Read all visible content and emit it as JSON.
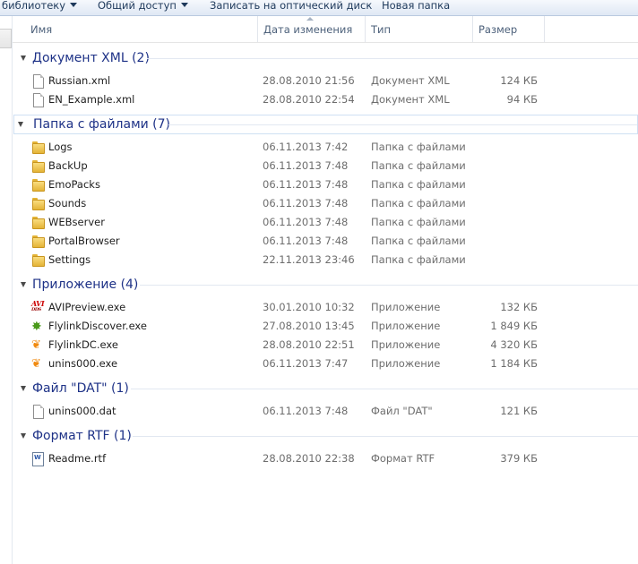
{
  "toolbar": {
    "library": "библиотеку",
    "share": "Общий доступ",
    "burn": "Записать на оптический диск",
    "new_folder": "Новая папка"
  },
  "columns": {
    "name": "Имя",
    "date": "Дата изменения",
    "type": "Тип",
    "size": "Размер"
  },
  "groups": [
    {
      "title": "Документ XML (2)",
      "items": [
        {
          "name": "Russian.xml",
          "date": "28.08.2010 21:56",
          "type": "Документ XML",
          "size": "124 КБ",
          "icon": "xml-file-icon"
        },
        {
          "name": "EN_Example.xml",
          "date": "28.08.2010 22:54",
          "type": "Документ XML",
          "size": "94 КБ",
          "icon": "xml-file-icon"
        }
      ]
    },
    {
      "title": "Папка с файлами (7)",
      "items": [
        {
          "name": "Logs",
          "date": "06.11.2013 7:42",
          "type": "Папка с файлами",
          "size": "",
          "icon": "folder-icon"
        },
        {
          "name": "BackUp",
          "date": "06.11.2013 7:48",
          "type": "Папка с файлами",
          "size": "",
          "icon": "folder-icon"
        },
        {
          "name": "EmoPacks",
          "date": "06.11.2013 7:48",
          "type": "Папка с файлами",
          "size": "",
          "icon": "folder-icon"
        },
        {
          "name": "Sounds",
          "date": "06.11.2013 7:48",
          "type": "Папка с файлами",
          "size": "",
          "icon": "folder-icon"
        },
        {
          "name": "WEBserver",
          "date": "06.11.2013 7:48",
          "type": "Папка с файлами",
          "size": "",
          "icon": "folder-icon"
        },
        {
          "name": "PortalBrowser",
          "date": "06.11.2013 7:48",
          "type": "Папка с файлами",
          "size": "",
          "icon": "folder-icon"
        },
        {
          "name": "Settings",
          "date": "22.11.2013 23:46",
          "type": "Папка с файлами",
          "size": "",
          "icon": "folder-icon"
        }
      ]
    },
    {
      "title": "Приложение (4)",
      "items": [
        {
          "name": "AVIPreview.exe",
          "date": "30.01.2010 10:32",
          "type": "Приложение",
          "size": "132 КБ",
          "icon": "avi-app-icon"
        },
        {
          "name": "FlylinkDiscover.exe",
          "date": "27.08.2010 13:45",
          "type": "Приложение",
          "size": "1 849 КБ",
          "icon": "green-star-app-icon"
        },
        {
          "name": "FlylinkDC.exe",
          "date": "28.08.2010 22:51",
          "type": "Приложение",
          "size": "4 320 КБ",
          "icon": "butterfly-app-icon"
        },
        {
          "name": "unins000.exe",
          "date": "06.11.2013 7:47",
          "type": "Приложение",
          "size": "1 184 КБ",
          "icon": "butterfly-app-icon"
        }
      ]
    },
    {
      "title": "Файл \"DAT\" (1)",
      "items": [
        {
          "name": "unins000.dat",
          "date": "06.11.2013 7:48",
          "type": "Файл \"DAT\"",
          "size": "121 КБ",
          "icon": "dat-file-icon"
        }
      ]
    },
    {
      "title": "Формат RTF (1)",
      "items": [
        {
          "name": "Readme.rtf",
          "date": "28.08.2010 22:38",
          "type": "Формат RTF",
          "size": "379 КБ",
          "icon": "rtf-file-icon"
        }
      ]
    }
  ]
}
